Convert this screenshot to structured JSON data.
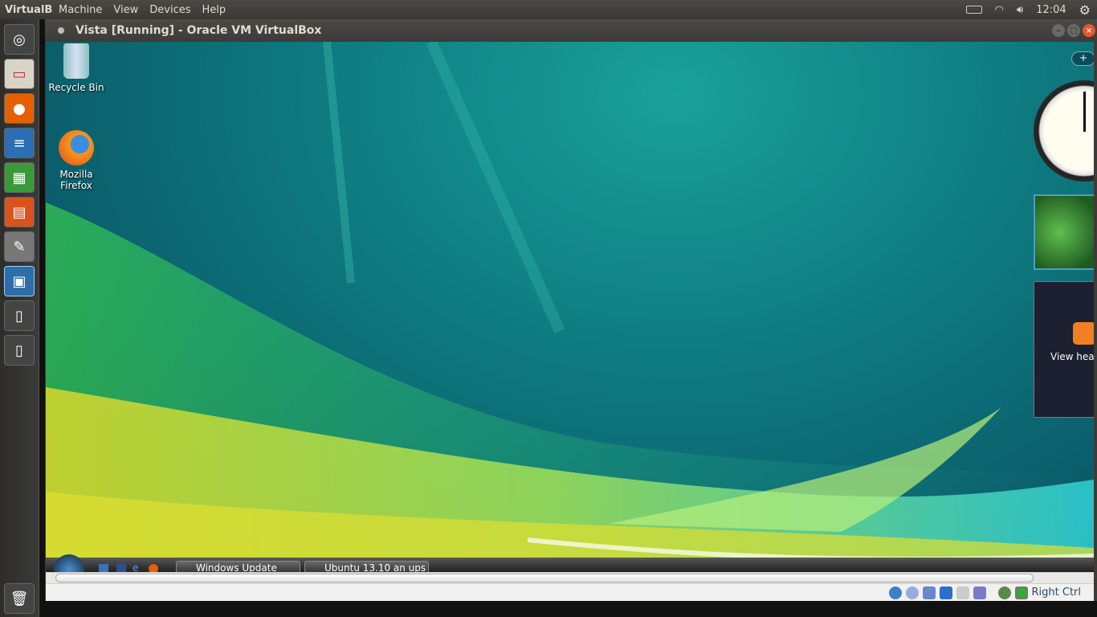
{
  "topbar": {
    "app_name": "VirtualBox",
    "menus": [
      "Machine",
      "View",
      "Devices",
      "Help"
    ],
    "clock": "12:04"
  },
  "launcher": {
    "items": [
      "Dash home",
      "Files",
      "Firefox",
      "LibreOffice Writer",
      "LibreOffice Calc",
      "LibreOffice Impress",
      "System Settings",
      "VirtualBox",
      "USB drive",
      "USB drive"
    ],
    "trash": "Trash"
  },
  "window": {
    "title": "Vista [Running] - Oracle VM VirtualBox"
  },
  "desktop": {
    "icons": [
      {
        "label": "Recycle Bin"
      },
      {
        "label": "Mozilla Firefox"
      }
    ],
    "sidebar": {
      "add_label": "+",
      "feed_text": "View headlines"
    }
  },
  "taskbar": {
    "tasks": [
      "Windows Update",
      "Ubuntu 13.10 an ups"
    ]
  },
  "statusbar": {
    "host_key": "Right Ctrl"
  },
  "colors": {
    "accent_close": "#e8572b",
    "wallpaper": "#0f7f84"
  }
}
